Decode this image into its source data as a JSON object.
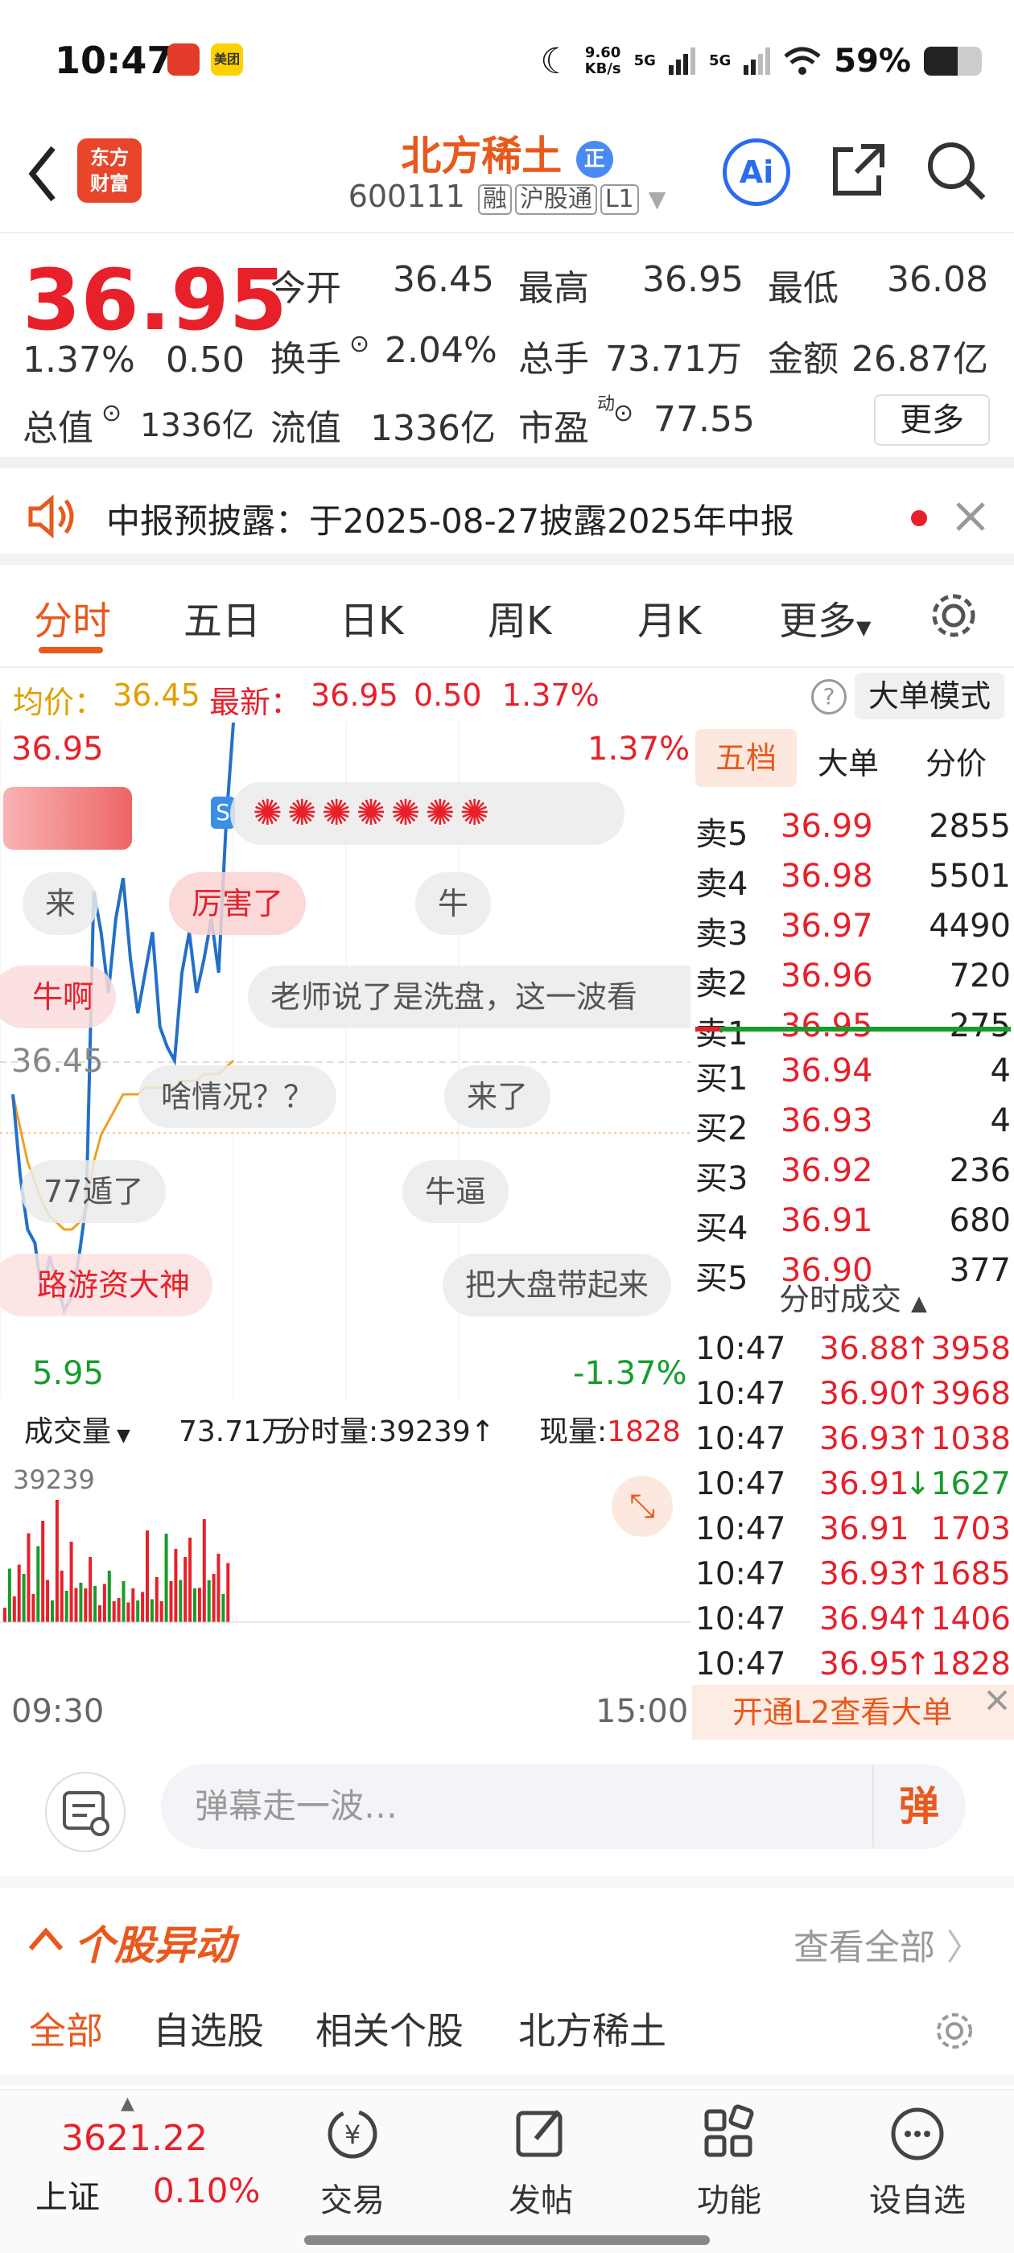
{
  "status_bar": {
    "time": "10:47",
    "net_speed_top": "9.60",
    "net_speed_bottom": "KB/s",
    "signal1": "5G",
    "signal2": "5G",
    "battery": "59%",
    "app_badge_1_icon": "red-app-icon",
    "app_badge_2_icon": "meituan-icon",
    "app_badge_2_text": "美团"
  },
  "header": {
    "logo_line1": "东方",
    "logo_line2": "财富",
    "stock_name": "北方稀土",
    "stock_badge": "正",
    "stock_code": "600111",
    "tags": [
      "融",
      "沪股通",
      "L1"
    ]
  },
  "quote": {
    "price": "36.95",
    "change_pct": "1.37%",
    "change": "0.50",
    "open_label": "今开",
    "open": "36.45",
    "high_label": "最高",
    "high": "36.95",
    "low_label": "最低",
    "low": "36.08",
    "turnover_label": "换手",
    "turnover": "2.04%",
    "volume_label": "总手",
    "volume": "73.71万",
    "amount_label": "金额",
    "amount": "26.87亿",
    "mktcap_label": "总值",
    "mktcap": "1336亿",
    "float_label": "流值",
    "float": "1336亿",
    "pe_label": "市盈",
    "pe_sup": "动",
    "pe": "77.55",
    "more_label": "更多"
  },
  "notice": {
    "text": "中报预披露：于2025-08-27披露2025年中报"
  },
  "tabs": [
    "分时",
    "五日",
    "日K",
    "周K",
    "月K",
    "更多"
  ],
  "avg_bar": {
    "avg_label": "均价：",
    "avg": "36.45",
    "last_label": "最新：",
    "last": "36.95",
    "change": "0.50",
    "pct": "1.37%",
    "mode": "大单模式"
  },
  "chart": {
    "top_price": "36.95",
    "top_pct": "1.37%",
    "mid_price": "36.45",
    "bottom_price": "5.95",
    "bottom_pct": "-1.37%",
    "vol_label": "成交量",
    "vol_total": "73.71万",
    "vol_min_label": "分时量:",
    "vol_min": "39239↑",
    "vol_now_label": "现量:",
    "vol_now": "1828",
    "vol_max": "39239",
    "time_start": "09:30",
    "time_end": "15:00"
  },
  "chart_data": {
    "type": "line",
    "price_series": [
      36.4,
      36.28,
      36.2,
      36.18,
      36.1,
      36.16,
      36.12,
      36.08,
      36.1,
      36.16,
      36.24,
      36.7,
      36.64,
      36.55,
      36.66,
      36.72,
      36.6,
      36.52,
      36.58,
      36.64,
      36.5,
      36.47,
      36.45,
      36.58,
      36.64,
      36.55,
      36.6,
      36.66,
      36.58,
      36.8,
      36.95
    ],
    "avg_series": [
      36.4,
      36.35,
      36.3,
      36.27,
      36.24,
      36.22,
      36.21,
      36.2,
      36.2,
      36.21,
      36.23,
      36.3,
      36.34,
      36.36,
      36.38,
      36.4,
      36.4,
      36.4,
      36.41,
      36.41,
      36.41,
      36.41,
      36.41,
      36.42,
      36.42,
      36.42,
      36.43,
      36.43,
      36.43,
      36.44,
      36.45
    ],
    "prev_close": 36.45,
    "ylim": [
      35.95,
      36.95
    ]
  },
  "danmaku": [
    "来",
    "厉害了",
    "牛",
    "牛啊",
    "老师说了是洗盘，这一波看",
    "啥情况？？",
    "来了",
    "77遁了",
    "牛逼",
    "路游资大神",
    "把大盘带起来"
  ],
  "order_book": {
    "tabs": [
      "五档",
      "大单",
      "分价"
    ],
    "asks": [
      {
        "label": "卖5",
        "price": "36.99",
        "vol": "2855"
      },
      {
        "label": "卖4",
        "price": "36.98",
        "vol": "5501"
      },
      {
        "label": "卖3",
        "price": "36.97",
        "vol": "4490"
      },
      {
        "label": "卖2",
        "price": "36.96",
        "vol": "720"
      },
      {
        "label": "卖1",
        "price": "36.95",
        "vol": "275"
      }
    ],
    "bids": [
      {
        "label": "买1",
        "price": "36.94",
        "vol": "4"
      },
      {
        "label": "买2",
        "price": "36.93",
        "vol": "4"
      },
      {
        "label": "买3",
        "price": "36.92",
        "vol": "236"
      },
      {
        "label": "买4",
        "price": "36.91",
        "vol": "680"
      },
      {
        "label": "买5",
        "price": "36.90",
        "vol": "377"
      }
    ],
    "ticks_title": "分时成交",
    "ticks": [
      {
        "t": "10:47",
        "p": "36.88",
        "v": "↑3958"
      },
      {
        "t": "10:47",
        "p": "36.90",
        "v": "↑3968"
      },
      {
        "t": "10:47",
        "p": "36.93",
        "v": "↑1038"
      },
      {
        "t": "10:47",
        "p": "36.91",
        "v": "↓1627"
      },
      {
        "t": "10:47",
        "p": "36.91",
        "v": "1703"
      },
      {
        "t": "10:47",
        "p": "36.93",
        "v": "↑1685"
      },
      {
        "t": "10:47",
        "p": "36.94",
        "v": "↑1406"
      },
      {
        "t": "10:47",
        "p": "36.95",
        "v": "↑1828"
      }
    ],
    "l2_text": "开通L2查看大单"
  },
  "comment": {
    "placeholder": "弹幕走一波…",
    "button": "弹"
  },
  "anomaly": {
    "title": "个股异动",
    "view_all": "查看全部"
  },
  "filters": [
    "全部",
    "自选股",
    "相关个股",
    "北方稀土"
  ],
  "bottom_nav": {
    "index_value": "3621.22",
    "index_name": "上证",
    "index_pct": "0.10%",
    "items": [
      "交易",
      "发帖",
      "功能",
      "设自选"
    ]
  },
  "colors": {
    "up": "#e8202a",
    "down": "#179c2b",
    "accent": "#e8591d"
  }
}
